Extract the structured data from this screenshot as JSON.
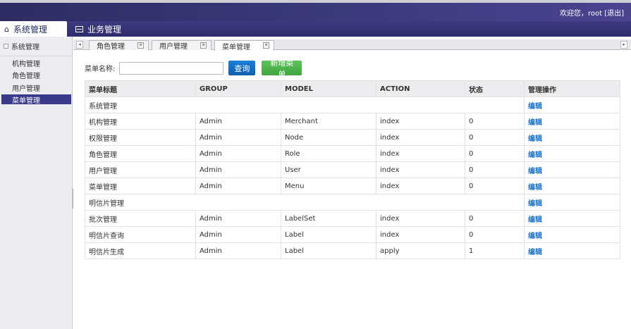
{
  "header": {
    "welcome_prefix": "欢迎您，",
    "username": "root",
    "logout": "[退出]"
  },
  "modules": {
    "home_icon": "home-icon",
    "system": "系统管理",
    "business": "业务管理"
  },
  "sidebar": {
    "group": "系统管理",
    "items": [
      "机构管理",
      "角色管理",
      "用户管理",
      "菜单管理"
    ],
    "active_index": 3
  },
  "page_tabs": [
    {
      "label": "角色管理"
    },
    {
      "label": "用户管理"
    },
    {
      "label": "菜单管理",
      "active": true
    }
  ],
  "search": {
    "label": "菜单名称:",
    "value": "",
    "query_button": "查询",
    "add_button": "新增菜单"
  },
  "table": {
    "columns": [
      "菜单标题",
      "GROUP",
      "MODEL",
      "ACTION",
      "状态",
      "管理操作"
    ],
    "rows": [
      {
        "title": "系统管理",
        "group": "",
        "model": "",
        "action": "",
        "status": "",
        "op": "编辑",
        "merged": true
      },
      {
        "title": "机构管理",
        "group": "Admin",
        "model": "Merchant",
        "action": "index",
        "status": "0",
        "op": "编辑"
      },
      {
        "title": "权限管理",
        "group": "Admin",
        "model": "Node",
        "action": "index",
        "status": "0",
        "op": "编辑"
      },
      {
        "title": "角色管理",
        "group": "Admin",
        "model": "Role",
        "action": "index",
        "status": "0",
        "op": "编辑"
      },
      {
        "title": "用户管理",
        "group": "Admin",
        "model": "User",
        "action": "index",
        "status": "0",
        "op": "编辑"
      },
      {
        "title": "菜单管理",
        "group": "Admin",
        "model": "Menu",
        "action": "index",
        "status": "0",
        "op": "编辑"
      },
      {
        "title": "明信片管理",
        "group": "",
        "model": "",
        "action": "",
        "status": "",
        "op": "编辑",
        "merged": true
      },
      {
        "title": "批次管理",
        "group": "Admin",
        "model": "LabelSet",
        "action": "index",
        "status": "0",
        "op": "编辑"
      },
      {
        "title": "明信片查询",
        "group": "Admin",
        "model": "Label",
        "action": "index",
        "status": "0",
        "op": "编辑"
      },
      {
        "title": "明信片生成",
        "group": "Admin",
        "model": "Label",
        "action": "apply",
        "status": "1",
        "op": "编辑"
      }
    ]
  }
}
